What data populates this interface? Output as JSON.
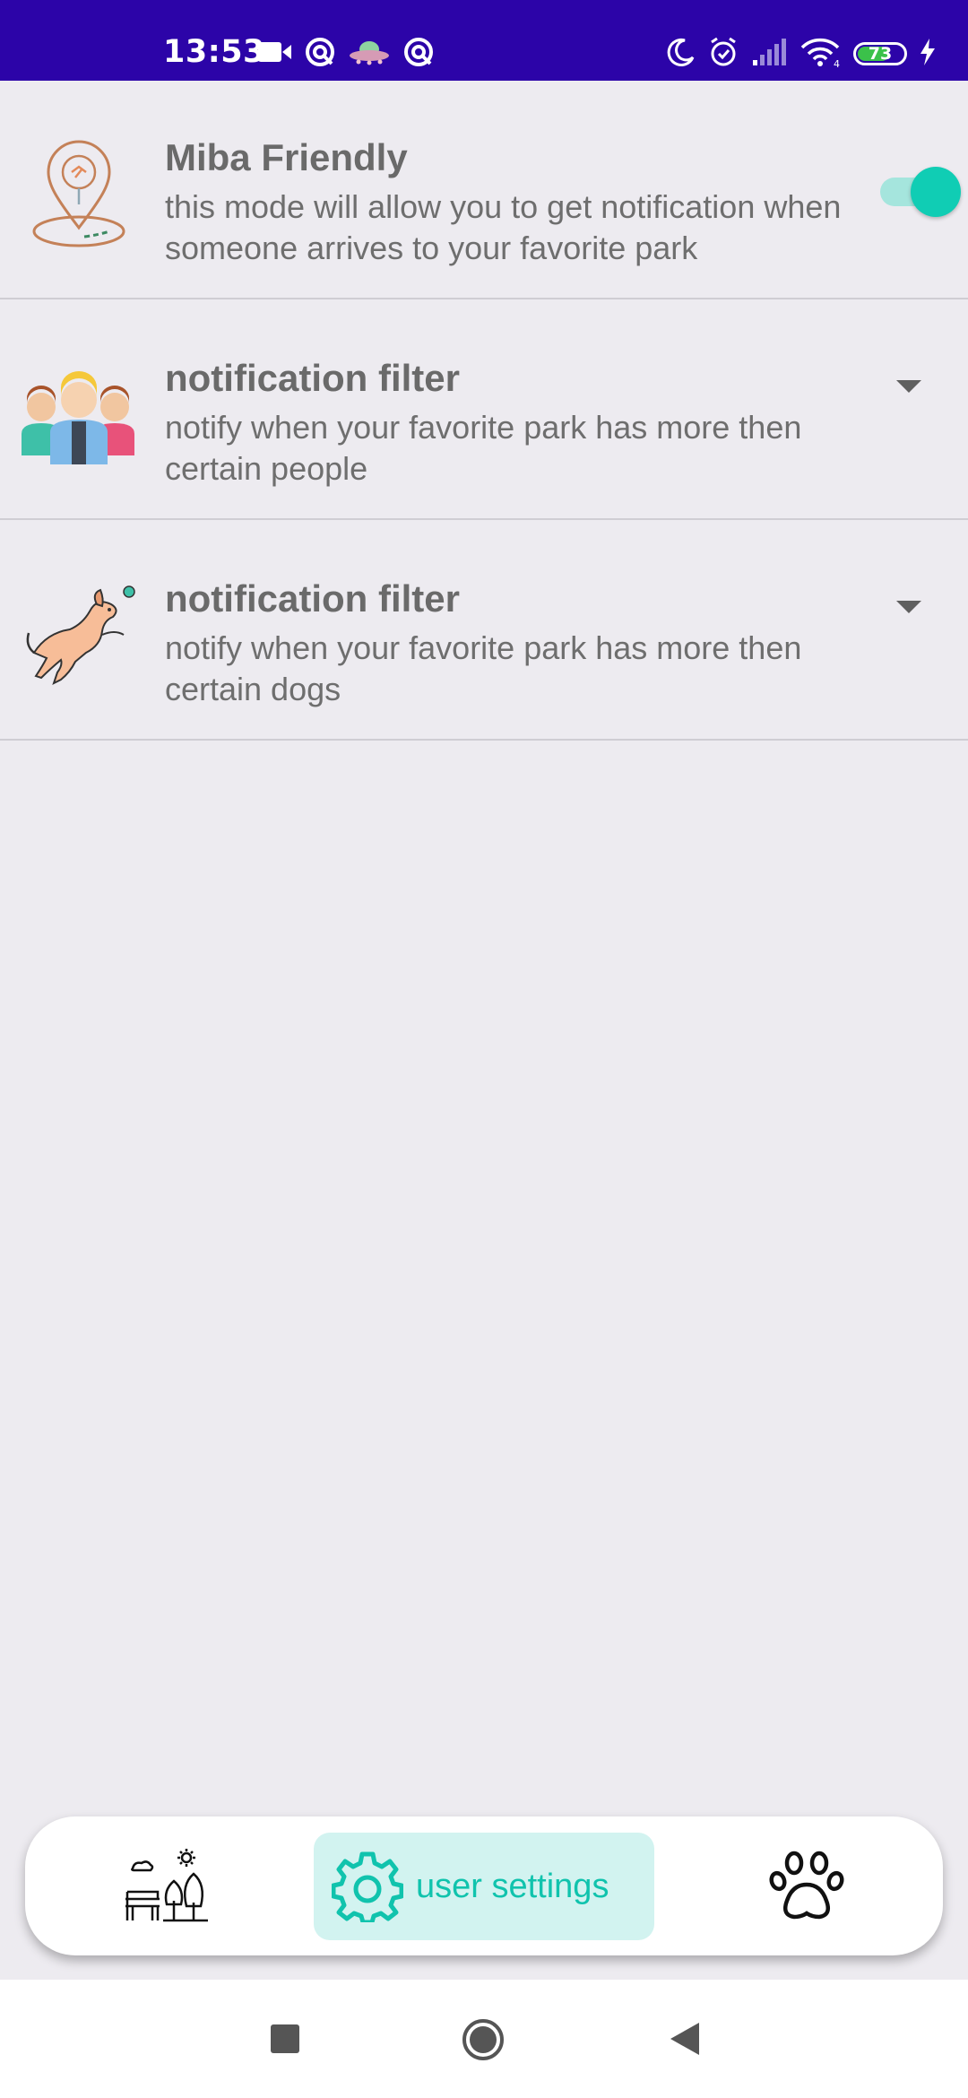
{
  "status_bar": {
    "time": "13:53",
    "battery_level": "73",
    "battery_percent": 73,
    "icons_left": [
      "video-camera-icon",
      "app-notification-icon",
      "ufo-notification-icon",
      "app-notification-icon"
    ],
    "icons_right": [
      "moon-icon",
      "alarm-icon",
      "signal-icon",
      "wifi-icon",
      "battery-icon",
      "charging-icon"
    ],
    "background_color": "#2c04a8"
  },
  "settings": {
    "miba_friendly": {
      "title": "Miba Friendly",
      "description": "this mode will allow you to get notification when someone arrives to your favorite park",
      "toggle_on": true,
      "icon": "location-pin-dog-icon"
    },
    "people_filter": {
      "title": "notification filter",
      "description": "notify when your favorite park has more then certain people",
      "icon": "people-group-icon"
    },
    "dogs_filter": {
      "title": "notification filter",
      "description": "notify when your favorite park has more then certain dogs",
      "icon": "jumping-dog-icon"
    }
  },
  "bottom_nav": {
    "park_icon": "park-bench-trees-icon",
    "settings_label": "user settings",
    "settings_icon": "gear-icon",
    "paw_icon": "paw-icon"
  },
  "colors": {
    "accent": "#10cdb4",
    "accent_light": "#d2f3f0",
    "background": "#edebf0",
    "text": "#6a6a6a"
  }
}
